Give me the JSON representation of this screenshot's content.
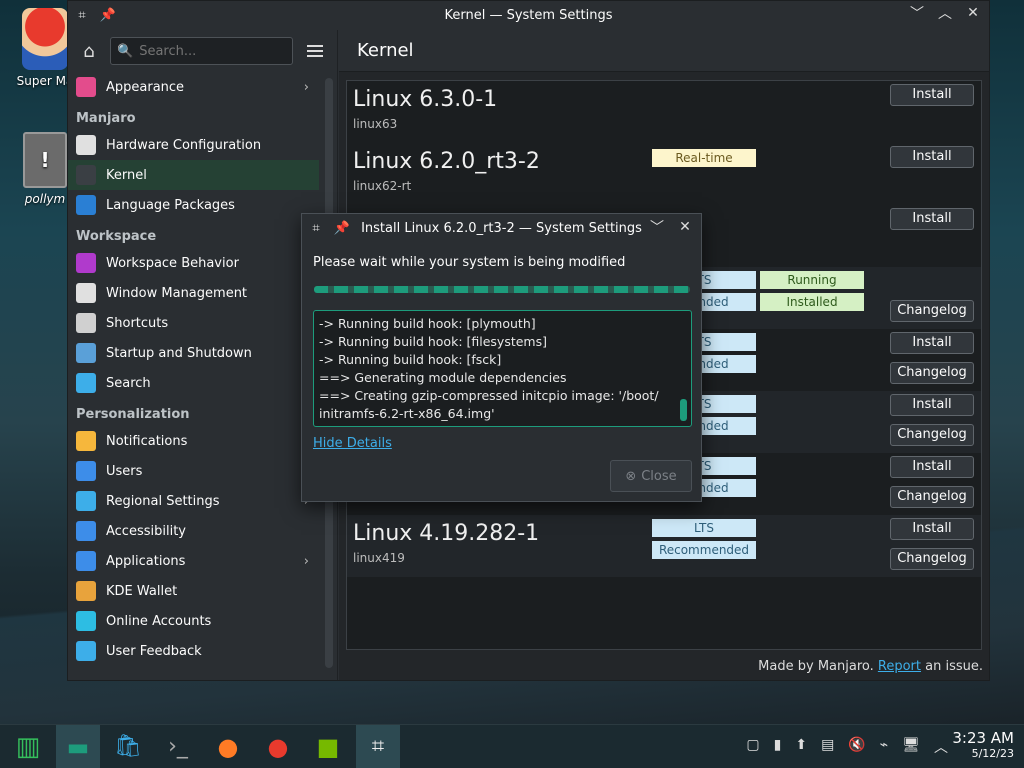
{
  "desktop": {
    "icons": [
      {
        "label": "Super Ma"
      },
      {
        "label": "pollym"
      }
    ]
  },
  "window": {
    "title": "Kernel — System Settings",
    "buttons": {
      "minimize": "﹀",
      "maximize": "︿",
      "close": "✕"
    }
  },
  "sidebar": {
    "search_placeholder": "Search...",
    "items": [
      {
        "type": "item",
        "label": "Appearance",
        "icon": "appearance-icon",
        "color": "#e34c8c",
        "arrow": true
      },
      {
        "type": "section",
        "label": "Manjaro"
      },
      {
        "type": "item",
        "label": "Hardware Configuration",
        "icon": "hardware-icon",
        "color": "#e0e0e0",
        "arrow": false
      },
      {
        "type": "item",
        "label": "Kernel",
        "icon": "kernel-icon",
        "color": "#3a3f44",
        "arrow": false,
        "active": true
      },
      {
        "type": "item",
        "label": "Language Packages",
        "icon": "language-icon",
        "color": "#2a7fd4",
        "arrow": false
      },
      {
        "type": "section",
        "label": "Workspace"
      },
      {
        "type": "item",
        "label": "Workspace Behavior",
        "icon": "workspace-icon",
        "color": "#b03acc",
        "arrow": true
      },
      {
        "type": "item",
        "label": "Window Management",
        "icon": "window-icon",
        "color": "#e0e0e0",
        "arrow": true
      },
      {
        "type": "item",
        "label": "Shortcuts",
        "icon": "shortcuts-icon",
        "color": "#d0d0d0",
        "arrow": true
      },
      {
        "type": "item",
        "label": "Startup and Shutdown",
        "icon": "startup-icon",
        "color": "#5aa0d8",
        "arrow": true
      },
      {
        "type": "item",
        "label": "Search",
        "icon": "search-icon",
        "color": "#3daee9",
        "arrow": true
      },
      {
        "type": "section",
        "label": "Personalization"
      },
      {
        "type": "item",
        "label": "Notifications",
        "icon": "bell-icon",
        "color": "#f6b73c",
        "arrow": false
      },
      {
        "type": "item",
        "label": "Users",
        "icon": "users-icon",
        "color": "#3d8de9",
        "arrow": false
      },
      {
        "type": "item",
        "label": "Regional Settings",
        "icon": "regional-icon",
        "color": "#3daee9",
        "arrow": true
      },
      {
        "type": "item",
        "label": "Accessibility",
        "icon": "accessibility-icon",
        "color": "#3d8de9",
        "arrow": false
      },
      {
        "type": "item",
        "label": "Applications",
        "icon": "applications-icon",
        "color": "#3d8de9",
        "arrow": true
      },
      {
        "type": "item",
        "label": "KDE Wallet",
        "icon": "wallet-icon",
        "color": "#e8a33c",
        "arrow": false
      },
      {
        "type": "item",
        "label": "Online Accounts",
        "icon": "online-accounts-icon",
        "color": "#2dbde3",
        "arrow": false
      },
      {
        "type": "item",
        "label": "User Feedback",
        "icon": "feedback-icon",
        "color": "#3daee9",
        "arrow": false
      }
    ]
  },
  "content": {
    "title": "Kernel",
    "kernels": [
      {
        "name": "Linux 6.3.0-1",
        "pkg": "linux63",
        "badges": [],
        "buttons": [
          "Install"
        ]
      },
      {
        "name": "Linux 6.2.0_rt3-2",
        "pkg": "linux62-rt",
        "badges": [
          {
            "text": "Real-time",
            "kind": "rt"
          }
        ],
        "buttons": [
          "Install"
        ]
      },
      {
        "name": "",
        "pkg": "",
        "badges": [],
        "buttons": [
          "Install"
        ]
      },
      {
        "name": "",
        "pkg": "",
        "badges": [
          {
            "text": "TS",
            "kind": "lts"
          },
          {
            "text": "mended",
            "kind": "lts"
          },
          {
            "text": "Running",
            "kind": "green"
          },
          {
            "text": "Installed",
            "kind": "green"
          }
        ],
        "buttons": [
          "Changelog"
        ]
      },
      {
        "name": "",
        "pkg": "",
        "badges": [
          {
            "text": "TS",
            "kind": "lts"
          },
          {
            "text": "mended",
            "kind": "lts"
          }
        ],
        "buttons": [
          "Install",
          "Changelog"
        ]
      },
      {
        "name": "",
        "pkg": "",
        "badges": [
          {
            "text": "TS",
            "kind": "lts"
          },
          {
            "text": "mended",
            "kind": "lts"
          }
        ],
        "buttons": [
          "Install",
          "Changelog"
        ]
      },
      {
        "name": "",
        "pkg": "",
        "badges": [
          {
            "text": "TS",
            "kind": "lts"
          },
          {
            "text": "mended",
            "kind": "lts"
          }
        ],
        "buttons": [
          "Install",
          "Changelog"
        ]
      },
      {
        "name": "Linux 4.19.282-1",
        "pkg": "linux419",
        "badges": [
          {
            "text": "LTS",
            "kind": "lts"
          },
          {
            "text": "Recommended",
            "kind": "lts"
          }
        ],
        "buttons": [
          "Install",
          "Changelog"
        ]
      }
    ],
    "footer_prefix": "Made by Manjaro.",
    "footer_link": "Report",
    "footer_suffix": "an issue."
  },
  "dialog": {
    "title": "Install Linux 6.2.0_rt3-2 — System Settings",
    "message": "Please wait while your system is being modified",
    "log_lines": [
      "-> Running build hook: [plymouth]",
      "-> Running build hook: [filesystems]",
      "-> Running build hook: [fsck]",
      "==> Generating module dependencies",
      "==> Creating gzip-compressed initcpio image: '/boot/",
      "initramfs-6.2-rt-x86_64.img'"
    ],
    "hide_details": "Hide Details",
    "close_label": "Close"
  },
  "taskbar": {
    "time": "3:23 AM",
    "date": "5/12/23"
  }
}
